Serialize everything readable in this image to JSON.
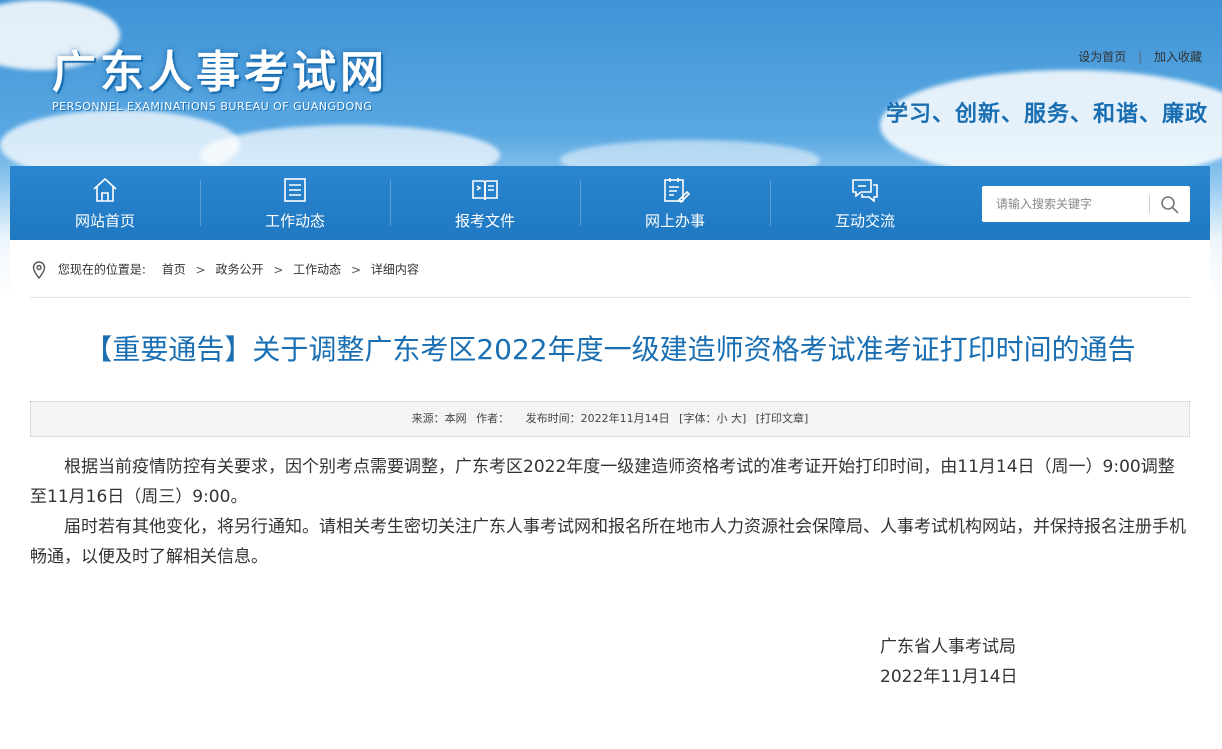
{
  "header": {
    "logo_title": "广东人事考试网",
    "logo_subtitle": "PERSONNEL EXAMINATIONS BUREAU OF GUANGDONG",
    "set_home": "设为首页",
    "separator": "|",
    "add_favorite": "加入收藏",
    "slogan": "学习、创新、服务、和谐、廉政"
  },
  "nav": {
    "items": [
      {
        "label": "网站首页",
        "icon": "home-icon"
      },
      {
        "label": "工作动态",
        "icon": "list-document-icon"
      },
      {
        "label": "报考文件",
        "icon": "open-book-icon"
      },
      {
        "label": "网上办事",
        "icon": "edit-clipboard-icon"
      },
      {
        "label": "互动交流",
        "icon": "chat-bubbles-icon"
      }
    ],
    "search_placeholder": "请输入搜索关键字"
  },
  "breadcrumb": {
    "prefix": "您现在的位置是:",
    "items": [
      "首页",
      "政务公开",
      "工作动态",
      "详细内容"
    ],
    "sep": ">"
  },
  "article": {
    "title": "【重要通告】关于调整广东考区2022年度一级建造师资格考试准考证打印时间的通告",
    "meta": {
      "source": "来源：本网",
      "author": "作者：",
      "date": "发布时间：2022年11月14日",
      "font_size": "[字体：小 大]",
      "print": "[打印文章]"
    },
    "paragraphs": [
      "根据当前疫情防控有关要求，因个别考点需要调整，广东考区2022年度一级建造师资格考试的准考证开始打印时间，由11月14日（周一）9:00调整至11月16日（周三）9:00。",
      "届时若有其他变化，将另行通知。请相关考生密切关注广东人事考试网和报名所在地市人力资源社会保障局、人事考试机构网站，并保持报名注册手机畅通，以便及时了解相关信息。"
    ],
    "signature": "广东省人事考试局",
    "sign_date": "2022年11月14日"
  },
  "colors": {
    "nav_bg": "#2080c8",
    "title_blue": "#1a6fb3",
    "slogan_blue": "#1a6fb3"
  }
}
